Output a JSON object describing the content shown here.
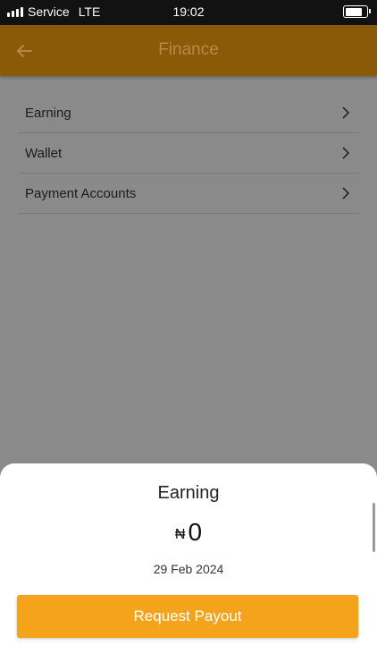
{
  "status_bar": {
    "carrier": "Service",
    "network": "LTE",
    "time": "19:02",
    "battery_level": 0.85
  },
  "app_bar": {
    "title": "Finance",
    "back_icon": "arrow-left-icon"
  },
  "menu": {
    "items": [
      {
        "label": "Earning",
        "icon": "chevron-right-icon"
      },
      {
        "label": "Wallet",
        "icon": "chevron-right-icon"
      },
      {
        "label": "Payment Accounts",
        "icon": "chevron-right-icon"
      }
    ]
  },
  "sheet": {
    "title": "Earning",
    "currency_symbol": "₦",
    "amount": "0",
    "date": "29 Feb 2024",
    "button_label": "Request Payout"
  },
  "colors": {
    "accent": "#f4a31a",
    "app_bar_dimmed": "#8a5a09",
    "overlay": "#8a8a8a"
  }
}
